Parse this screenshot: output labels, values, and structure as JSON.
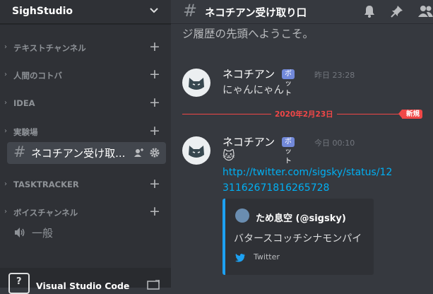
{
  "server": {
    "name": "SighStudio"
  },
  "categories": [
    {
      "label": "テキストチャンネル"
    },
    {
      "label": "人間のコトバ"
    },
    {
      "label": "IDEA"
    },
    {
      "label": "実験場"
    },
    {
      "label": "TASKTRACKER"
    },
    {
      "label": "ボイスチャンネル"
    }
  ],
  "active_channel": {
    "name": "ネコチアン受け取..."
  },
  "voice_channel": {
    "name": "一般"
  },
  "activity": {
    "app": "Visual Studio Code",
    "icon_text": "?"
  },
  "header": {
    "channel_title": "ネコチアン受け取り口"
  },
  "chat": {
    "welcome_text": "ジ履歴の先頭へようこそ。",
    "messages": [
      {
        "author": "ネコチアン",
        "badge": "ボット",
        "time": "昨日 23:28",
        "text": "にゃんにゃん"
      },
      {
        "author": "ネコチアン",
        "badge": "ボット",
        "time": "今日 00:10",
        "emoji": "🐱",
        "link": "http://twitter.com/sigsky/status/1231162671816265728"
      }
    ],
    "divider": {
      "date": "2020年2月23日",
      "new_label": "新規"
    },
    "embed": {
      "author": "ため息空 (@sigsky)",
      "description": "バタースコッチシナモンパイ",
      "footer": "Twitter",
      "accent": "#1da1f2"
    }
  },
  "colors": {
    "background": "#36393f",
    "sidebar": "#2f3136",
    "accent": "#7289da",
    "new": "#f04747",
    "link": "#00b0f4"
  }
}
